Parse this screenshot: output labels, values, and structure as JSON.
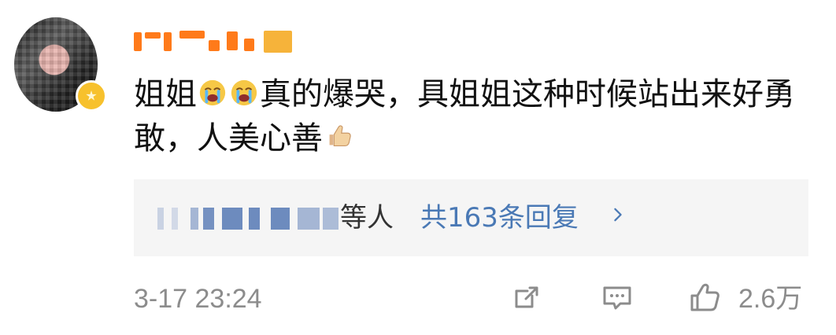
{
  "comment": {
    "username": "",
    "text_part1": "姐姐",
    "text_part2": "真的爆哭，具姐姐这种时候站出来好勇敢，人美心善",
    "emojis": [
      "crying-face-icon",
      "crying-face-icon",
      "thumbs-up-emoji-icon"
    ]
  },
  "replies": {
    "masked_names": "",
    "suffix": "等人",
    "count_text": "共163条回复",
    "chevron_icon": "chevron-right-icon"
  },
  "meta": {
    "time": "3-17 23:24",
    "likes": "2.6万"
  },
  "actions": [
    "share-icon",
    "comment-icon",
    "like-icon"
  ],
  "colors": {
    "accent": "#4a79b5",
    "meta_text": "#8c8c8c",
    "reply_bg": "#f5f5f5",
    "username_bar": "#ff7a1a",
    "badge": "#f7c12d"
  }
}
